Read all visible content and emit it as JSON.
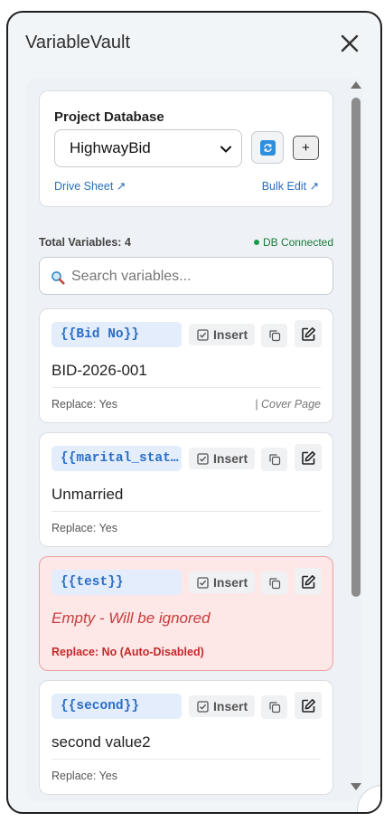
{
  "app": {
    "title": "VariableVault"
  },
  "database": {
    "label": "Project Database",
    "selected": "HighwayBid",
    "sync_icon": "sync-icon",
    "add_label": "+",
    "drive_link": "Drive Sheet ↗",
    "bulk_link": "Bulk Edit ↗"
  },
  "stats": {
    "total": "Total Variables: 4",
    "status": "DB Connected"
  },
  "search": {
    "placeholder": "Search variables..."
  },
  "variables": [
    {
      "key": "{{Bid No}}",
      "insert": "Insert",
      "value": "BID-2026-001",
      "replace": "Replace: Yes",
      "section": "| Cover Page"
    },
    {
      "key": "{{marital_status}}",
      "insert": "Insert",
      "value": "Unmarried",
      "replace": "Replace: Yes",
      "section": ""
    },
    {
      "key": "{{test}}",
      "insert": "Insert",
      "value": "Empty - Will be ignored",
      "replace": "Replace: No (Auto-Disabled)",
      "section": ""
    },
    {
      "key": "{{second}}",
      "insert": "Insert",
      "value": "second value2",
      "replace": "Replace: Yes",
      "section": ""
    }
  ],
  "colors": {
    "accent": "#2a6ec6",
    "connected": "#1a7b3c",
    "error": "#c83c3c"
  }
}
